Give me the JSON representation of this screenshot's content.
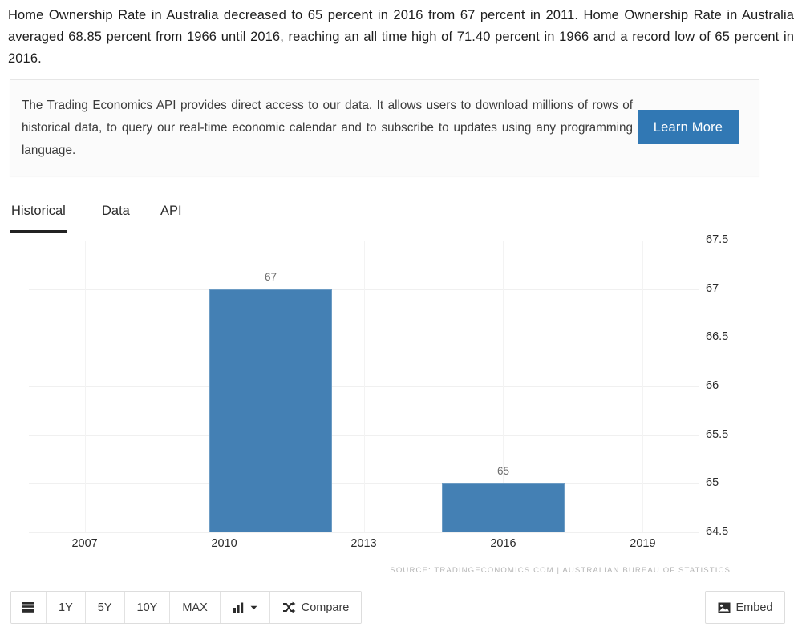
{
  "intro": {
    "paragraph": "Home Ownership Rate in Australia decreased to 65 percent in 2016 from 67 percent in 2011. Home Ownership Rate in Australia averaged 68.85 percent from 1966 until 2016, reaching an all time high of 71.40 percent in 1966 and a record low of 65 percent in 2016."
  },
  "api_promo": {
    "text": "The Trading Economics API provides direct access to our data. It allows users to download millions of rows of historical data, to query our real-time economic calendar and to subscribe to updates using any programming language.",
    "button_label": "Learn More",
    "button_color": "#3178b4"
  },
  "tabs": [
    {
      "label": "Historical",
      "active": true
    },
    {
      "label": "Data",
      "active": false
    },
    {
      "label": "API",
      "active": false
    }
  ],
  "chart_data": {
    "type": "bar",
    "title": "",
    "xlabel": "",
    "ylabel": "",
    "categories": [
      2011,
      2016
    ],
    "values": [
      67,
      65
    ],
    "data_labels": [
      "67",
      "65"
    ],
    "bar_color": "#4480b4",
    "ylim": [
      64.5,
      67.5
    ],
    "yticks": [
      67.5,
      67,
      66.5,
      66,
      65.5,
      65,
      64.5
    ],
    "ytick_labels": [
      "67.5",
      "67",
      "66.5",
      "66",
      "65.5",
      "65",
      "64.5"
    ],
    "xlim": [
      2005.8,
      2020.2
    ],
    "xticks": [
      2007,
      2010,
      2013,
      2016,
      2019
    ],
    "xtick_labels": [
      "2007",
      "2010",
      "2013",
      "2016",
      "2019"
    ],
    "grid": true,
    "legend": false
  },
  "source_note": "SOURCE: TRADINGECONOMICS.COM | AUSTRALIAN BUREAU OF STATISTICS",
  "toolbar": {
    "buttons": [
      {
        "name": "list-view",
        "label": "",
        "icon": "list-icon"
      },
      {
        "name": "range-1y",
        "label": "1Y",
        "icon": ""
      },
      {
        "name": "range-5y",
        "label": "5Y",
        "icon": ""
      },
      {
        "name": "range-10y",
        "label": "10Y",
        "icon": ""
      },
      {
        "name": "range-max",
        "label": "MAX",
        "icon": ""
      },
      {
        "name": "chart-type",
        "label": "",
        "icon": "bar-chart-caret-icon"
      },
      {
        "name": "compare",
        "label": "Compare",
        "icon": "shuffle-icon"
      }
    ],
    "embed_label": "Embed"
  }
}
